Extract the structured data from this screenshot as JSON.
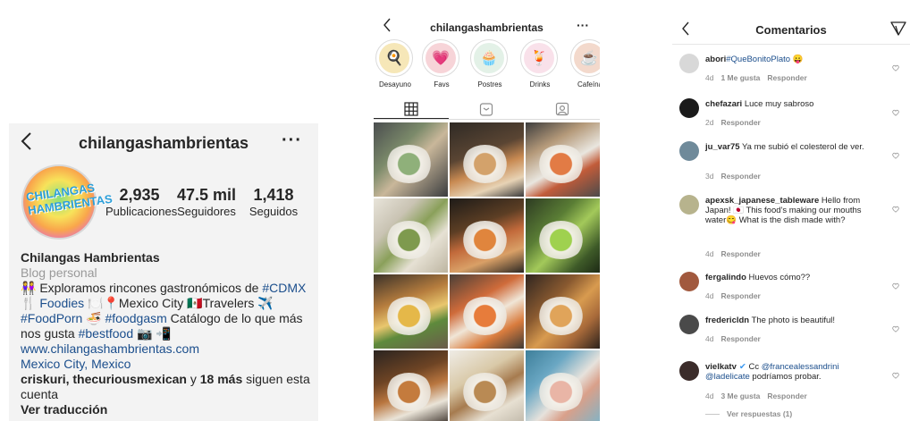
{
  "profile": {
    "username": "chilangashambrientas",
    "more": "···",
    "avatar_text": "CHILANGAS HAMBRIENTAS",
    "stats": [
      {
        "value": "2,935",
        "label": "Publicaciones"
      },
      {
        "value": "47.5 mil",
        "label": "Seguidores"
      },
      {
        "value": "1,418",
        "label": "Seguidos"
      }
    ],
    "display_name": "Chilangas Hambrientas",
    "category": "Blog personal",
    "bio": {
      "line1_emoji": "👭",
      "line1_text": " Exploramos rincones gastronómicos de ",
      "line1_tag": "#CDMX",
      "line2_emoji1": "🍴",
      "line2_tag": "Foodies",
      "line2_emoji2": " 🍽️📍",
      "line2_text": "Mexico City 🇲🇽Travelers ✈️",
      "line3_tag1": "#FoodPorn",
      "line3_emoji": " 🍜 ",
      "line3_tag2": "#foodgasm",
      "line3_text": " Catálogo de lo que más",
      "line4_text": "nos gusta ",
      "line4_tag": "#bestfood",
      "line4_emoji": " 📷 📲"
    },
    "website": "www.chilangashambrientas.com",
    "location": "Mexico City, Mexico",
    "followed_by_names": "criskuri, thecuriousmexican",
    "followed_by_mid": " y ",
    "followed_by_more": "18 más",
    "followed_by_tail": " siguen esta cuenta",
    "translate": "Ver traducción"
  },
  "grid_view": {
    "username": "chilangashambrientas",
    "more": "···",
    "highlights": [
      {
        "label": "Desayuno",
        "emoji": "🍳",
        "bg": "#f6e7b8"
      },
      {
        "label": "Favs",
        "emoji": "💗",
        "bg": "#f7d4d8"
      },
      {
        "label": "Postres",
        "emoji": "🧁",
        "bg": "#e3f1e7"
      },
      {
        "label": "Drinks",
        "emoji": "🍹",
        "bg": "#f9e1ea"
      },
      {
        "label": "Cafeína",
        "emoji": "☕",
        "bg": "#f3d9cc"
      }
    ],
    "photos": [
      {
        "name": "photo-matcha-dessert",
        "bg": "linear-gradient(135deg,#4a4d4f 0%,#7b8a6a 35%,#c9b79a 55%,#3a3c3e 100%)",
        "accent": "#8fb07a"
      },
      {
        "name": "photo-coffee-cake",
        "bg": "linear-gradient(160deg,#2f2a25 0%,#5a4533 40%,#c88a52 60%,#e7d3b5 80%,#3b3b3b 100%)",
        "accent": "#d3a26b"
      },
      {
        "name": "photo-chicken-plate",
        "bg": "linear-gradient(150deg,#3d3d3d 0%,#b59a7a 30%,#e9e6df 55%,#c25c3a 70%,#4b4b4b 100%)",
        "accent": "#e27b45"
      },
      {
        "name": "photo-salad-bowl",
        "bg": "linear-gradient(135deg,#e8e4da 0%,#c9c3b3 30%,#8aa05a 50%,#e6e1d4 70%,#bdb5a1 100%)",
        "accent": "#7e9a4e"
      },
      {
        "name": "photo-cocktail-plate",
        "bg": "linear-gradient(160deg,#1e1b18 0%,#5c3e24 35%,#c26a3b 55%,#d9a067 75%,#2a2622 100%)",
        "accent": "#e0853d"
      },
      {
        "name": "photo-green-salad",
        "bg": "linear-gradient(135deg,#2d3b22 0%,#5a7d35 35%,#a3c95a 55%,#3e5a28 80%,#1d2a15 100%)",
        "accent": "#9fd14f"
      },
      {
        "name": "photo-chilaquiles",
        "bg": "linear-gradient(160deg,#3a3129 0%,#b67d3e 35%,#e9c76e 55%,#5e8a3c 70%,#6b5b4b 100%)",
        "accent": "#e5b849"
      },
      {
        "name": "photo-enchiladas",
        "bg": "linear-gradient(150deg,#4a3f38 0%,#cf6b3a 35%,#f0e6d7 55%,#d97c3e 75%,#3f3a34 100%)",
        "accent": "#e77c3b"
      },
      {
        "name": "photo-pasta",
        "bg": "linear-gradient(135deg,#2f2520 0%,#8a5a30 35%,#d89b4f 55%,#a86a3a 75%,#2c221c 100%)",
        "accent": "#e0a45a"
      },
      {
        "name": "photo-roast-chicken",
        "bg": "linear-gradient(160deg,#2b2420 0%,#6e4424 35%,#b9763f 55%,#eae4d8 75%,#3a3029 100%)",
        "accent": "#c47b3d"
      },
      {
        "name": "photo-noodles",
        "bg": "linear-gradient(150deg,#efece6 0%,#d9c9a8 35%,#a67b4f 55%,#e7e0d2 75%,#bfb7a8 100%)",
        "accent": "#b98a54"
      },
      {
        "name": "photo-pink-wine",
        "bg": "linear-gradient(135deg,#3e7f9a 0%,#6aa7c3 30%,#e6e2dc 55%,#d9a08a 70%,#7fb4c8 100%)",
        "accent": "#e9b5a6"
      }
    ]
  },
  "comments_view": {
    "title": "Comentarios",
    "comments": [
      {
        "username": "abori",
        "text": "",
        "tag": "#QueBonitoPlato",
        "emoji": " 😛",
        "meta_time": "4d",
        "meta_likes": "1 Me gusta",
        "meta_reply": "Responder",
        "avatar_bg": "#d8d8d8"
      },
      {
        "username": "chefazari",
        "text": " Luce muy sabroso",
        "tag": "",
        "emoji": "",
        "meta_time": "2d",
        "meta_likes": "",
        "meta_reply": "Responder",
        "avatar_bg": "#1a1a1a"
      },
      {
        "username": "ju_var75",
        "text": " Ya me subió el colesterol de ver.",
        "tag": "",
        "emoji": "",
        "meta_time": "3d",
        "meta_likes": "",
        "meta_reply": "Responder",
        "avatar_bg": "#6f8a9a"
      },
      {
        "username": "apexsk_japanese_tableware",
        "text": " Hello from Japan! 🇯🇵 This food's making our mouths water😋 What is the dish made with?",
        "tag": "",
        "emoji": "",
        "meta_time": "4d",
        "meta_likes": "",
        "meta_reply": "Responder",
        "avatar_bg": "#b7b38d"
      },
      {
        "username": "fergalindo",
        "text": " Huevos cómo??",
        "tag": "",
        "emoji": "",
        "meta_time": "4d",
        "meta_likes": "",
        "meta_reply": "Responder",
        "avatar_bg": "#a1593e"
      },
      {
        "username": "fredericldn",
        "text": " The photo is beautiful!",
        "tag": "",
        "emoji": "",
        "meta_time": "4d",
        "meta_likes": "",
        "meta_reply": "Responder",
        "avatar_bg": "#4a4a4a"
      },
      {
        "username": "vielkatv",
        "verified": "✔",
        "text": " Cc ",
        "tag": "@francealessandrini @ladelicate",
        "emoji": "",
        "tail": " podríamos probar.",
        "meta_time": "4d",
        "meta_likes": "3 Me gusta",
        "meta_reply": "Responder",
        "avatar_bg": "#3b2c2a"
      }
    ],
    "view_replies": "Ver respuestas (1)"
  }
}
